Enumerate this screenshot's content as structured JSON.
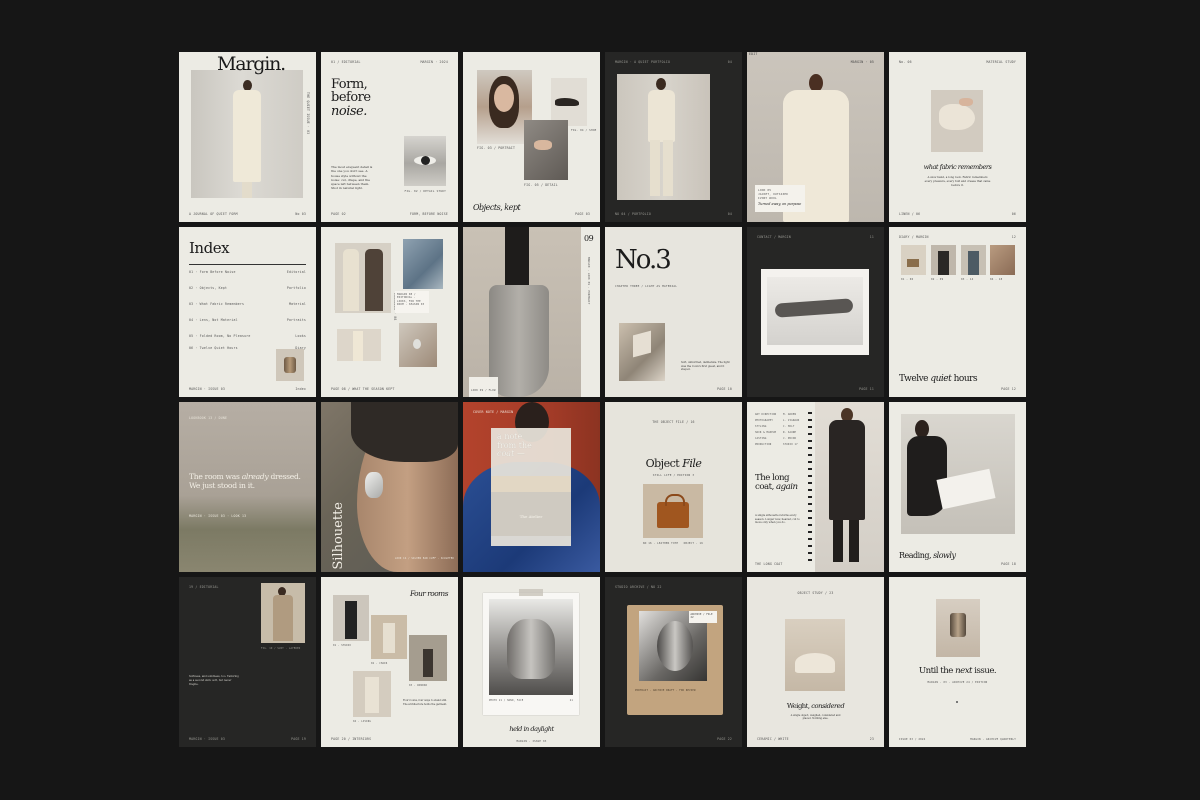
{
  "colors": {
    "background": "#161616",
    "paper": "#ecebe4",
    "dark": "#262625"
  },
  "pages": [
    {
      "title": "Margin.",
      "footer_left": "A JOURNAL OF QUIET FORM",
      "footer_right": "No 03",
      "spine": "THE QUIET ISSUE · 03"
    },
    {
      "top_left": "01 / EDITORIAL",
      "top_right": "MARGIN · 2024",
      "title_1": "Form,",
      "title_2": "before",
      "title_3": "noise.",
      "body": "The most eloquent detail is the one you don't see. A house style without the noise: cut, drape, and the space left between them. Shot in natural light.",
      "caption": "FIG. 02 / DETAIL STUDY",
      "footer_left": "PAGE 02",
      "footer_right": "FORM, BEFORE NOISE"
    },
    {
      "caption_1": "FIG. 03 / PORTRAIT",
      "caption_2": "FIG. 04 / SHOE",
      "caption_3": "FIG. 05 / DETAIL",
      "title": "Objects, kept",
      "footer": "PAGE 03"
    },
    {
      "top_left": "MARGIN · A QUIET PORTFOLIO",
      "top_right": "04",
      "footer_left": "NO 04 / PORTFOLIO",
      "footer_right": "04"
    },
    {
      "top_left": "EDIT",
      "top_right": "MARGIN · 05",
      "note_1": "LOOK 05",
      "note_2": "JACKET, OUTSIZED",
      "note_3": "IVORY WOOL",
      "note_4": "Turned away, on purpose"
    },
    {
      "top_left": "No. 06",
      "top_right": "MATERIAL STUDY",
      "title": "what fabric remembers",
      "body": "A slow hand, a long look. Fabric remembers every pressure, every fold and crease that came before it.",
      "footer_left": "LINEN / 06",
      "footer_right": "06"
    },
    {
      "title": "Index",
      "rows": [
        {
          "n": "01 · Form Before Noise",
          "p": "Editorial"
        },
        {
          "n": "02 · Objects, Kept",
          "p": "Portfolio"
        },
        {
          "n": "03 · What Fabric Remembers",
          "p": "Material"
        },
        {
          "n": "04 · Lens, Not Material",
          "p": "Portraits"
        },
        {
          "n": "05 · Folded Room, No Pleasure",
          "p": "Looks"
        },
        {
          "n": "06 · Twelve Quiet Hours",
          "p": "Diary"
        }
      ],
      "footer_left": "MARGIN · ISSUE 03",
      "footer_right": "Index"
    },
    {
      "side": "LOOKBOOK · 08",
      "note": "MARGIN 08 / EDITORIAL · LOOKS, FOR THE ROOM · SEASON 03",
      "footer": "PAGE 08 / WHAT THE SEASON KEPT"
    },
    {
      "number": "09",
      "spine": "MARGIN · LOOK 09 · PORTRAIT",
      "caption": "LOOK 09 / FLOW"
    },
    {
      "title": "No.3",
      "sub": "CHAPTER THREE / LIGHT AS MATERIAL",
      "body": "Soft, unhurried, deliberate. The light was the room's first guest, and it stayed.",
      "footer": "PAGE 10"
    },
    {
      "top_left": "CONTACT / MARGIN",
      "top_right": "11",
      "footer": "PAGE 11"
    },
    {
      "top_left": "DIARY / MARGIN",
      "top_right": "12",
      "caps": [
        "01 · 06",
        "02 · 09",
        "03 · 14",
        "04 · 18"
      ],
      "title_1": "Twelve ",
      "title_2": "quiet",
      "title_3": " hours",
      "footer": "PAGE 12"
    },
    {
      "top": "LOOKBOOK 13 / DUNE",
      "quote_1": "The room was ",
      "quote_2": "already",
      "quote_3": " dressed.",
      "quote_4": "We just stood in it.",
      "footer": "MARGIN · ISSUE 03 · LOOK 13"
    },
    {
      "vertical": "Silhouette",
      "caption": "LOOK 14 / SILVER EAR CUFF · SCULPTED"
    },
    {
      "top": "COVER NOTE / MARGIN",
      "card_1": "a note",
      "card_2": "from the",
      "card_3": "coat —",
      "card_4": "The Atelier"
    },
    {
      "top": "THE OBJECT FILE / 16",
      "title_1": "Object ",
      "title_2": "File",
      "sub": "STILL LIFE / EDITION 3",
      "cap_l": "NO 16 · LEATHER TOTE",
      "cap_r": "OBJECT · 16"
    },
    {
      "list": [
        "ART DIRECTION",
        "PHOTOGRAPHY",
        "STYLING",
        "HAIR & MAKEUP",
        "CASTING",
        "PRODUCTION"
      ],
      "names": [
        "M. ARDEN",
        "L. VIGNAUD",
        "C. HOLT",
        "R. SAUNE",
        "J. PRIOR",
        "STUDIO 17"
      ],
      "title_1": "The long",
      "title_2": "coat, ",
      "title_3": "again",
      "body": "A single silhouette returns every season. Longer now, heavier, cut to move only when you do.",
      "footer": "THE LONG COAT"
    },
    {
      "title_1": "Reading, ",
      "title_2": "slowly",
      "footer": "PAGE 18"
    },
    {
      "top": "19 / EDITORIAL",
      "caption": "FIG. 19 / SUIT · LAYERED",
      "body": "Softness, and solidness, too. Tailoring as a second skin: soft, but never fragile.",
      "footer_left": "MARGIN · ISSUE 03",
      "footer_right": "PAGE 19"
    },
    {
      "title": "Four rooms",
      "caps": [
        "01 · STUDIO",
        "02 · CHAIR",
        "03 · WINDOW",
        "04 · LIVING"
      ],
      "body": "Four rooms, four ways to stand still. The architecture holds the garment.",
      "footer": "PAGE 20 / INTERIORS"
    },
    {
      "cap_l": "PHOTO 21 / HAND, FACE",
      "cap_r": "21",
      "title": "held in daylight",
      "footer": "MARGIN · ISSUE 03"
    },
    {
      "top": "STUDIO ARCHIVE / NO 22",
      "tab": "ARCHIVE / FILE 22",
      "caption": "PORTRAIT · ARCHIVE DRAFT · FOR REVIEW",
      "footer": "PAGE 22"
    },
    {
      "top": "OBJECT STUDY / 23",
      "title_1": "Weight, ",
      "title_2": "considered",
      "body": "A single object, weighed, considered and placed. Nothing else.",
      "footer_left": "CERAMIC / WHITE",
      "footer_right": "23"
    },
    {
      "title_1": "Until the ",
      "title_2": "next",
      "title_3": " issue.",
      "sub": "MARGIN · 03 · ARCHIVE 24 / EDITION",
      "footer_left": "ISSUE 03 / 2024",
      "footer_right": "MARGIN · ARCHIVE QUARTERLY"
    }
  ]
}
